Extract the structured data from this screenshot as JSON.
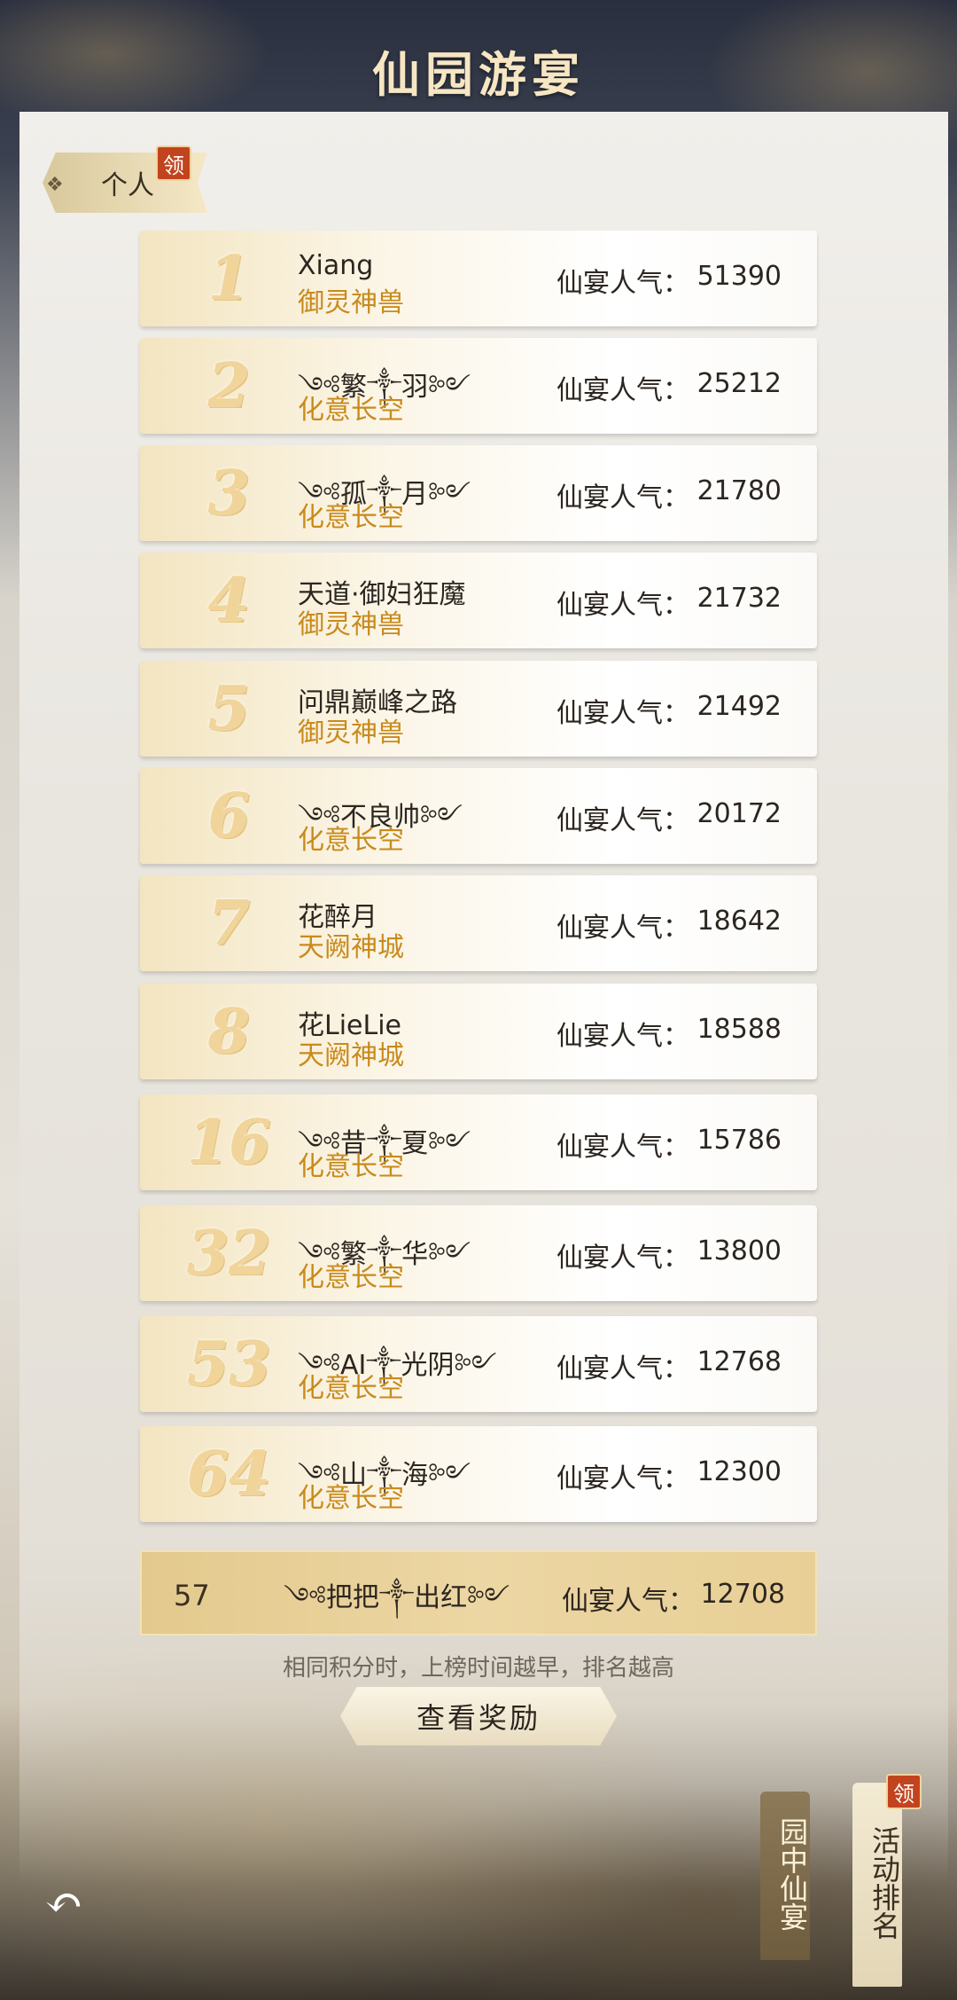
{
  "header": {
    "title": "仙园游宴"
  },
  "tabs": {
    "personal_label": "个人",
    "personal_badge": "领"
  },
  "rankings": [
    {
      "rank": "1",
      "name": "Xiang",
      "server": "御灵神兽",
      "score_label": "仙宴人气：",
      "score": "51390"
    },
    {
      "rank": "2",
      "name": "༺繁༒羽༻",
      "server": "化意长空",
      "score_label": "仙宴人气：",
      "score": "25212"
    },
    {
      "rank": "3",
      "name": "༺孤༒月༻",
      "server": "化意长空",
      "score_label": "仙宴人气：",
      "score": "21780"
    },
    {
      "rank": "4",
      "name": "天道·御妇狂魔",
      "server": "御灵神兽",
      "score_label": "仙宴人气：",
      "score": "21732"
    },
    {
      "rank": "5",
      "name": "问鼎巅峰之路",
      "server": "御灵神兽",
      "score_label": "仙宴人气：",
      "score": "21492"
    },
    {
      "rank": "6",
      "name": "༺不良帅༻",
      "server": "化意长空",
      "score_label": "仙宴人气：",
      "score": "20172"
    },
    {
      "rank": "7",
      "name": "花醉月",
      "server": "天阙神城",
      "score_label": "仙宴人气：",
      "score": "18642"
    },
    {
      "rank": "8",
      "name": "花LieLie",
      "server": "天阙神城",
      "score_label": "仙宴人气：",
      "score": "18588"
    },
    {
      "rank": "16",
      "name": "༺昔༒夏༻",
      "server": "化意长空",
      "score_label": "仙宴人气：",
      "score": "15786"
    },
    {
      "rank": "32",
      "name": "༺繁༒华༻",
      "server": "化意长空",
      "score_label": "仙宴人气：",
      "score": "13800"
    },
    {
      "rank": "53",
      "name": "༺AI༒光阴༻",
      "server": "化意长空",
      "score_label": "仙宴人气：",
      "score": "12768"
    },
    {
      "rank": "64",
      "name": "༺山༒海༻",
      "server": "化意长空",
      "score_label": "仙宴人气：",
      "score": "12300"
    }
  ],
  "self": {
    "rank": "57",
    "name": "༺把把༒出红༻",
    "score_label": "仙宴人气：",
    "score": "12708"
  },
  "footer": {
    "note": "相同积分时，上榜时间越早，排名越高",
    "reward_button": "查看奖励",
    "back_icon": "↶"
  },
  "side_tags": {
    "feast": "园中仙宴",
    "activity_rank": "活动排名",
    "activity_badge": "领"
  }
}
